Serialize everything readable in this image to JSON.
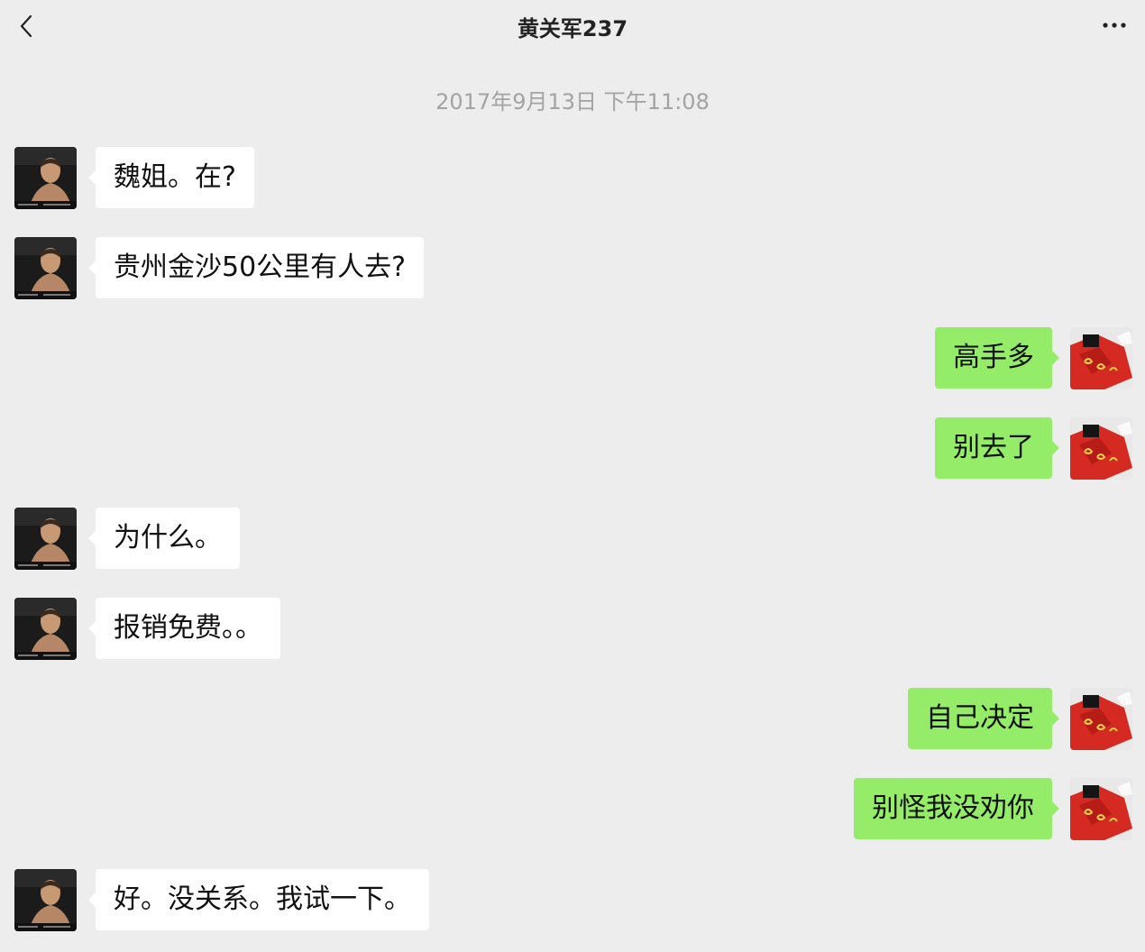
{
  "header": {
    "title": "黄关军237"
  },
  "timestamp": "2017年9月13日 下午11:08",
  "colors": {
    "background": "#ededed",
    "incoming_bubble": "#ffffff",
    "outgoing_bubble": "#95ec69",
    "timestamp_text": "#a3a3a3"
  },
  "messages": [
    {
      "side": "left",
      "text": "魏姐。在?"
    },
    {
      "side": "left",
      "text": "贵州金沙50公里有人去?"
    },
    {
      "side": "right",
      "text": "高手多"
    },
    {
      "side": "right",
      "text": "别去了"
    },
    {
      "side": "left",
      "text": "为什么。"
    },
    {
      "side": "left",
      "text": "报销免费。。"
    },
    {
      "side": "right",
      "text": "自己决定"
    },
    {
      "side": "right",
      "text": "别怪我没劝你"
    },
    {
      "side": "left",
      "text": "好。没关系。我试一下。"
    }
  ]
}
